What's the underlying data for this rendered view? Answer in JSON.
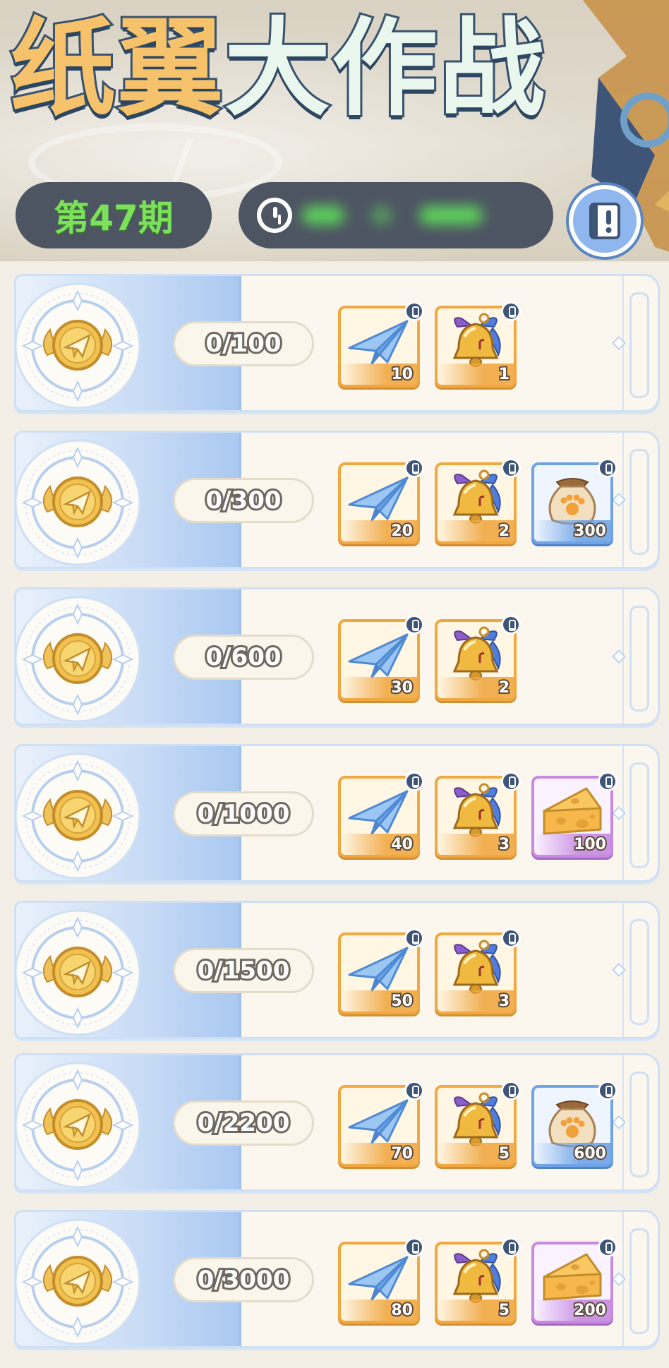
{
  "header": {
    "title_part1": "纸翼",
    "title_part2": "大作战",
    "issue_label": "第47期",
    "timer": "",
    "colors": {
      "title_orange": "#f6c36c",
      "title_mint": "#eaf7ee",
      "outline": "#39536e",
      "pill": "#4d5562",
      "issue_green": "#7be05a"
    }
  },
  "icons": {
    "timer": "clock-icon",
    "rules": "book-exclamation-icon",
    "medal": "winged-coin-medal-icon",
    "items": [
      "paper-plane-icon",
      "golden-bell-icon",
      "paw-sack-icon",
      "cheese-icon"
    ]
  },
  "rewards": [
    {
      "progress": "0/100",
      "items": [
        {
          "icon": "paper-plane-icon",
          "frame": "orange",
          "qty": "10"
        },
        {
          "icon": "golden-bell-icon",
          "frame": "orange",
          "qty": "1"
        }
      ]
    },
    {
      "progress": "0/300",
      "items": [
        {
          "icon": "paper-plane-icon",
          "frame": "orange",
          "qty": "20"
        },
        {
          "icon": "golden-bell-icon",
          "frame": "orange",
          "qty": "2"
        },
        {
          "icon": "paw-sack-icon",
          "frame": "blue",
          "qty": "300"
        }
      ]
    },
    {
      "progress": "0/600",
      "items": [
        {
          "icon": "paper-plane-icon",
          "frame": "orange",
          "qty": "30"
        },
        {
          "icon": "golden-bell-icon",
          "frame": "orange",
          "qty": "2"
        }
      ]
    },
    {
      "progress": "0/1000",
      "items": [
        {
          "icon": "paper-plane-icon",
          "frame": "orange",
          "qty": "40"
        },
        {
          "icon": "golden-bell-icon",
          "frame": "orange",
          "qty": "3"
        },
        {
          "icon": "cheese-icon",
          "frame": "purple",
          "qty": "100"
        }
      ]
    },
    {
      "progress": "0/1500",
      "items": [
        {
          "icon": "paper-plane-icon",
          "frame": "orange",
          "qty": "50"
        },
        {
          "icon": "golden-bell-icon",
          "frame": "orange",
          "qty": "3"
        }
      ]
    },
    {
      "progress": "0/2200",
      "items": [
        {
          "icon": "paper-plane-icon",
          "frame": "orange",
          "qty": "70"
        },
        {
          "icon": "golden-bell-icon",
          "frame": "orange",
          "qty": "5"
        },
        {
          "icon": "paw-sack-icon",
          "frame": "blue",
          "qty": "600"
        }
      ]
    },
    {
      "progress": "0/3000",
      "items": [
        {
          "icon": "paper-plane-icon",
          "frame": "orange",
          "qty": "80"
        },
        {
          "icon": "golden-bell-icon",
          "frame": "orange",
          "qty": "5"
        },
        {
          "icon": "cheese-icon",
          "frame": "purple",
          "qty": "200"
        }
      ]
    }
  ]
}
